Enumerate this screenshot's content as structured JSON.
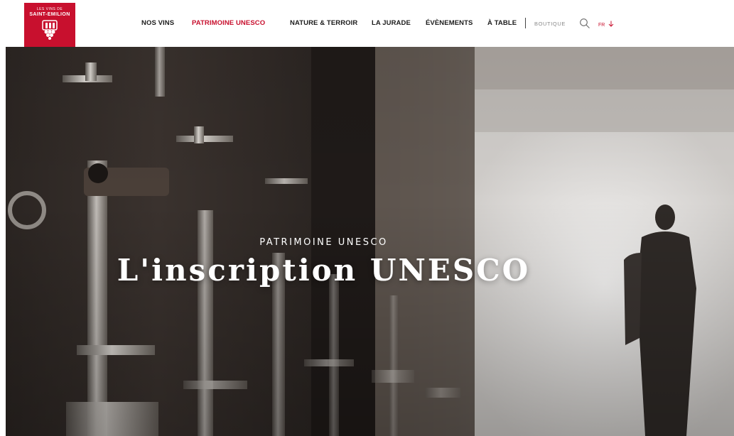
{
  "header": {
    "logo": {
      "small": "LES VINS DE",
      "main": "SAINT-EMILION"
    },
    "nav": [
      {
        "label": "NOS VINS"
      },
      {
        "label": "PATRIMOINE UNESCO",
        "active": true
      },
      {
        "label": "NATURE & TERROIR"
      },
      {
        "label": "LA JURADE"
      },
      {
        "label": "ÉVÈNEMENTS"
      },
      {
        "label": "À TABLE"
      }
    ],
    "shop": "BOUTIQUE",
    "search_icon": "search-icon",
    "lang": "FR",
    "lang_icon": "arrow-down-icon"
  },
  "hero": {
    "kicker": "PATRIMOINE UNESCO",
    "title": "L'inscription UNESCO"
  },
  "colors": {
    "brand": "#c8102e",
    "nav_text": "#1c1c1c",
    "muted": "#8a8a8a"
  }
}
